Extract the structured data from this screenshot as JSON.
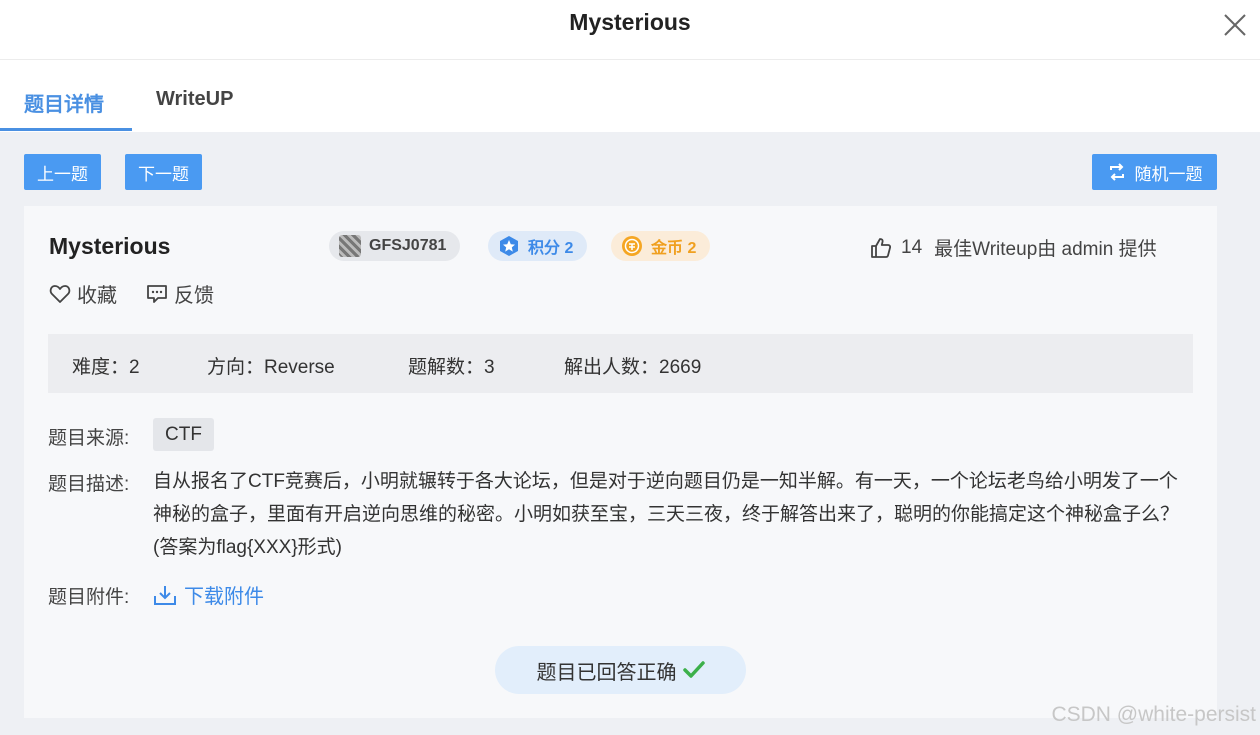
{
  "header": {
    "title": "Mysterious"
  },
  "tabs": [
    {
      "label": "题目详情",
      "active": true
    },
    {
      "label": "WriteUP",
      "active": false
    }
  ],
  "toolbar": {
    "prev_label": "上一题",
    "next_label": "下一题",
    "random_label": "随机一题"
  },
  "problem": {
    "title": "Mysterious",
    "id_badge": "GFSJ0781",
    "score_badge": "积分 2",
    "coin_badge": "金币 2",
    "likes": "14",
    "best_writeup": "最佳Writeup由 admin 提供",
    "favorite_label": "收藏",
    "feedback_label": "反馈"
  },
  "stats": {
    "difficulty": "难度：2",
    "direction": "方向：Reverse",
    "solutions": "题解数：3",
    "solvers": "解出人数：2669"
  },
  "details": {
    "source_label": "题目来源:",
    "source_value": "CTF",
    "desc_label": "题目描述:",
    "desc_text": "自从报名了CTF竞赛后，小明就辗转于各大论坛，但是对于逆向题目仍是一知半解。有一天，一个论坛老鸟给小明发了一个神秘的盒子，里面有开启逆向思维的秘密。小明如获至宝，三天三夜，终于解答出来了，聪明的你能搞定这个神秘盒子么？(答案为flag{XXX}形式)",
    "attach_label": "题目附件:",
    "attach_link": "下载附件"
  },
  "status": {
    "answered": "题目已回答正确"
  },
  "watermark": "CSDN @white-persist",
  "colors": {
    "accent": "#4a90e2",
    "button": "#4a9af2",
    "success": "#3cb04a",
    "coin": "#f0a020"
  },
  "icons": [
    "close-icon",
    "random-icon",
    "id-icon",
    "star-icon",
    "coin-icon",
    "thumb-up-icon",
    "heart-icon",
    "feedback-icon",
    "download-icon",
    "check-icon"
  ]
}
